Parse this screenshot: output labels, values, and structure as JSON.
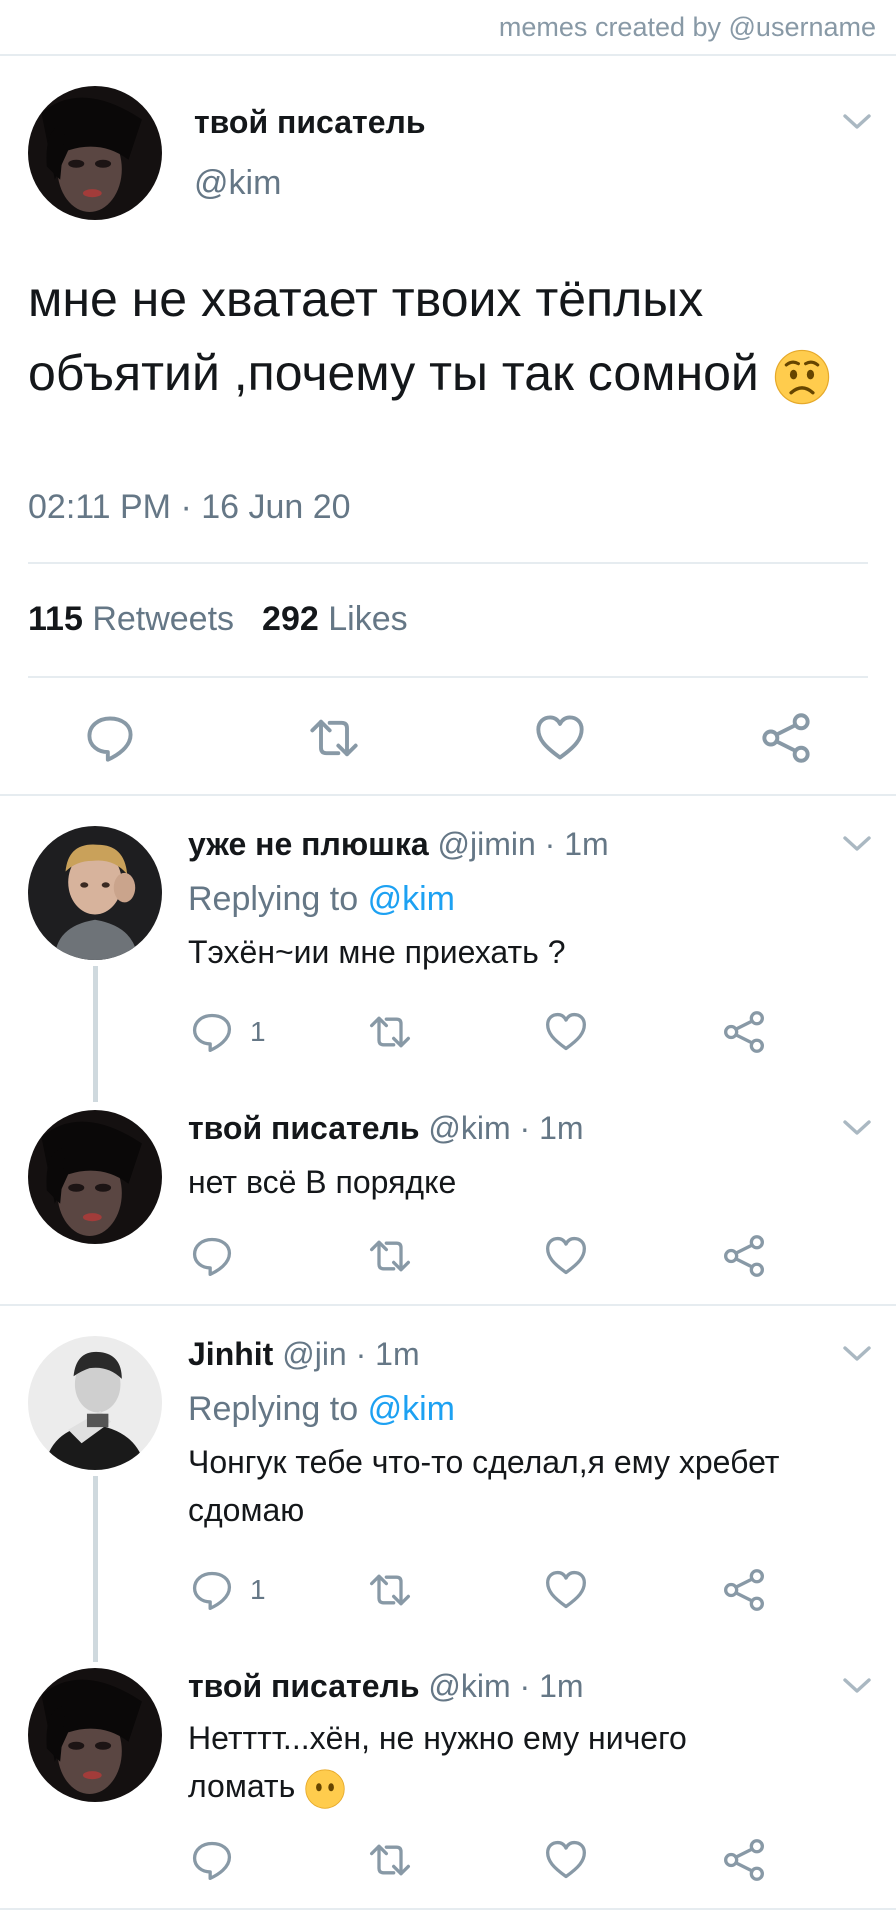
{
  "header": {
    "credit": "memes created by @username"
  },
  "main_tweet": {
    "display_name": "твой писатель",
    "handle": "@kim",
    "text": "мне не хватает твоих  тёплых объятий ,почему ты так сомной",
    "emoji": "worried-face",
    "timestamp": "02:11 PM · 16 Jun 20",
    "retweets_count": "115",
    "retweets_label": "Retweets",
    "likes_count": "292",
    "likes_label": "Likes"
  },
  "replies": [
    {
      "display_name": "уже не плюшка",
      "handle": "@jimin",
      "time": "· 1m",
      "replying_label": "Replying to",
      "replying_handle": "@kim",
      "text": "Тэхён~ии мне приехать ?",
      "reply_count": "1"
    },
    {
      "display_name": "твой писатель",
      "handle": "@kim",
      "time": "· 1m",
      "text": "нет всё  В порядке"
    },
    {
      "display_name": "Jinhit",
      "handle": "@jin",
      "time": "· 1m",
      "replying_label": "Replying to",
      "replying_handle": "@kim",
      "text": "Чонгук тебе что-то сделал,я ему хребет сдомаю",
      "reply_count": "1"
    },
    {
      "display_name": "твой писатель",
      "handle": "@kim",
      "time": "· 1m",
      "text": "Нетттт...хён, не нужно ему ничего ломать",
      "emoji": "face-without-mouth"
    }
  ],
  "icons": {
    "reply": "reply-icon",
    "retweet": "retweet-icon",
    "like": "heart-icon",
    "share": "share-icon",
    "menu": "chevron-down-icon"
  },
  "colors": {
    "link": "#1da1f2",
    "secondary": "#657786",
    "divider": "#e6ecf0"
  }
}
